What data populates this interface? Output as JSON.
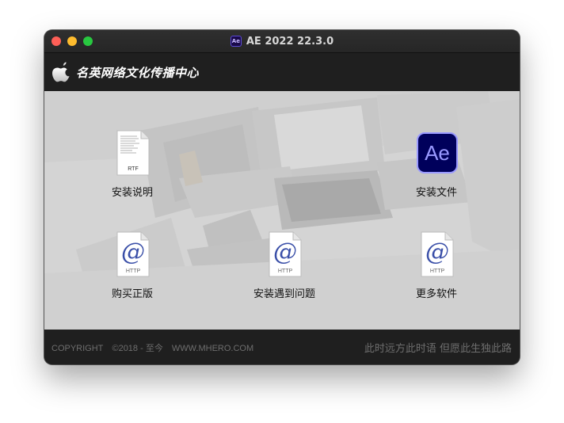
{
  "window": {
    "title": "AE 2022 22.3.0",
    "title_icon_text": "Ae"
  },
  "header": {
    "brand": "名英网络文化传播中心",
    "logo_icon": "apple-icon"
  },
  "items": [
    {
      "label": "安装说明",
      "icon": "rtf-document-icon",
      "icon_text": "RTF"
    },
    {
      "label": "安装文件",
      "icon": "after-effects-icon",
      "icon_text": "Ae"
    },
    {
      "label": "购买正版",
      "icon": "http-link-icon",
      "icon_text": "HTTP"
    },
    {
      "label": "安装遇到问题",
      "icon": "http-link-icon",
      "icon_text": "HTTP"
    },
    {
      "label": "更多软件",
      "icon": "http-link-icon",
      "icon_text": "HTTP"
    }
  ],
  "footer": {
    "copyright": "COPYRIGHT",
    "years": "©2018 - 至今",
    "website": "WWW.MHERO.COM",
    "motto": "此时远方此时语 但愿此生独此路"
  },
  "colors": {
    "ae_bg": "#00005b",
    "ae_accent": "#9999ff",
    "close": "#fe5f57",
    "minimize": "#febc2e",
    "zoom": "#28c840"
  }
}
